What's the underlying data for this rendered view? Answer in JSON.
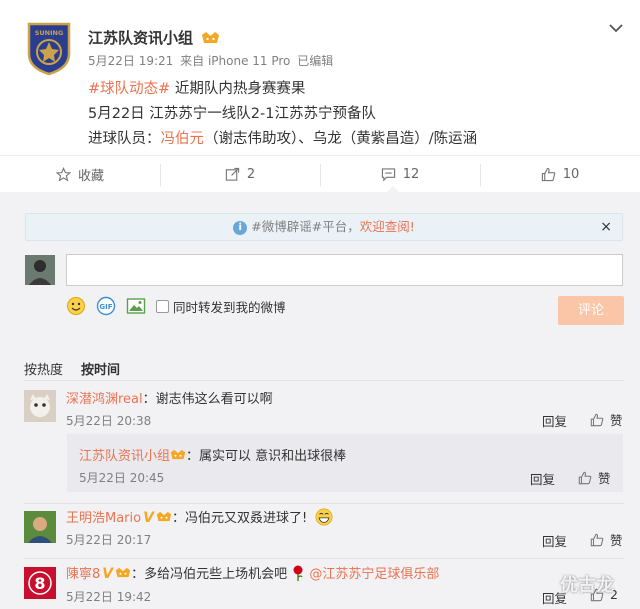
{
  "post": {
    "author": "江苏队资讯小组",
    "date": "5月22日 19:21",
    "source": "来自 iPhone 11 Pro",
    "edited": "已编辑",
    "line1_tag": "#球队动态#",
    "line1_text": " 近期队内热身赛赛果",
    "line2": "5月22日 江苏苏宁一线队2-1江苏苏宁预备队",
    "line3_prefix": "进球队员：",
    "line3_name": "冯伯元",
    "line3_rest": "（谢志伟助攻）、乌龙（黄紫昌造）/陈运涵",
    "logo_text": "SUNING"
  },
  "actions": {
    "favorite": "收藏",
    "repost": "2",
    "comment": "12",
    "like": "10"
  },
  "notice": {
    "text": "#微博辟谣#平台，",
    "link": "欢迎查阅!",
    "close": "×"
  },
  "composer": {
    "input_value": "",
    "checkbox_label": "同时转发到我的微博",
    "submit": "评论"
  },
  "sort": {
    "hot": "按热度",
    "time": "按时间"
  },
  "comments": [
    {
      "user": "深潜鸿渊real",
      "text": "：谢志伟这么看可以啊",
      "time": "5月22日 20:38",
      "reply": "回复",
      "like": "赞"
    },
    {
      "user": "江苏队资讯小组",
      "text": "：属实可以 意识和出球很棒",
      "time": "5月22日 20:45",
      "reply": "回复",
      "like": "赞"
    },
    {
      "user": "王明浩Mario",
      "text": "：冯伯元又双叒进球了!",
      "time": "5月22日 20:17",
      "reply": "回复",
      "like": "赞"
    },
    {
      "user": "陳寧8",
      "text": "：多给冯伯元些上场机会吧",
      "mention": "@江苏苏宁足球俱乐部",
      "time": "5月22日 19:42",
      "reply": "回复",
      "like": "2"
    }
  ],
  "watermark": "优古龙",
  "colors": {
    "accent": "#eb7350",
    "link_blue": "#4d8dc9",
    "vip_gold": "#f5a623"
  }
}
